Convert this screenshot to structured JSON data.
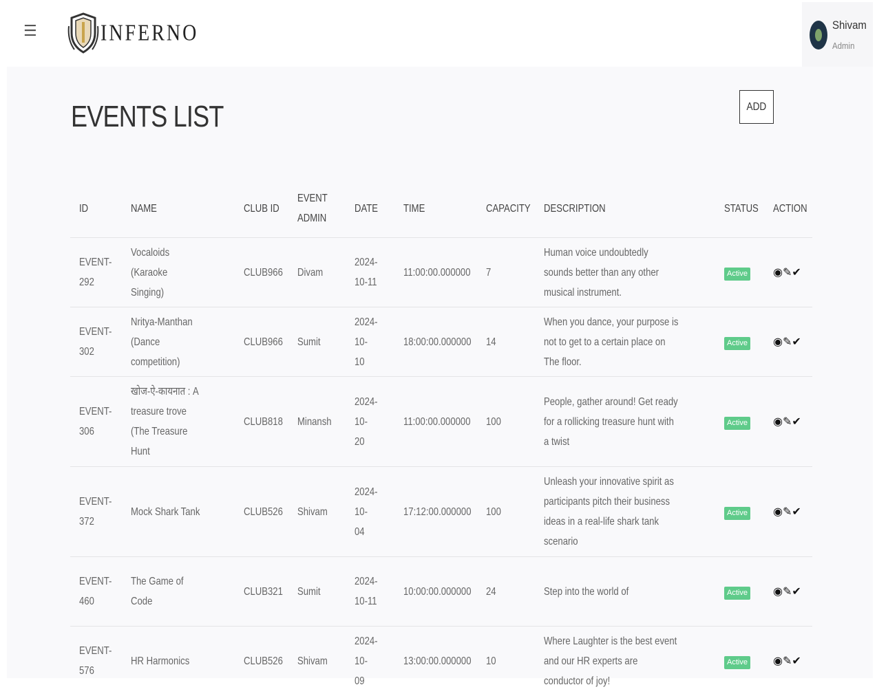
{
  "header": {
    "menu_icon": "hamburger-icon",
    "logo_text": "INFERNO",
    "user": {
      "name": "Shivam",
      "role": "Admin"
    }
  },
  "page": {
    "title": "EVENTS LIST",
    "add_label": "ADD"
  },
  "table": {
    "columns": [
      "ID",
      "NAME",
      "CLUB ID",
      "EVENT ADMIN",
      "DATE",
      "TIME",
      "CAPACITY",
      "DESCRIPTION",
      "STATUS",
      "ACTION"
    ],
    "rows": [
      {
        "id": "EVENT-292",
        "name": "Vocaloids (Karaoke Singing)",
        "club": "CLUB966",
        "admin": "Divam",
        "date": "2024-10-11",
        "time": "11:00:00.000000",
        "capacity": "7",
        "description": "Human voice undoubtedly sounds better than any other musical instrument.",
        "status": "Active"
      },
      {
        "id": "EVENT-302",
        "name": "Nritya-Manthan (Dance competition)",
        "club": "CLUB966",
        "admin": "Sumit",
        "date": "2024-10-10",
        "time": "18:00:00.000000",
        "capacity": "14",
        "description": "When you dance, your purpose is not to get to a certain place on The floor.",
        "status": "Active"
      },
      {
        "id": "EVENT-306",
        "name": "खोज-ऐ-कायनात : A treasure trove (The Treasure Hunt",
        "club": "CLUB818",
        "admin": "Minansh",
        "date": "2024-10-20",
        "time": "11:00:00.000000",
        "capacity": "100",
        "description": "People, gather around! Get ready for a rollicking treasure hunt with a twist",
        "status": "Active"
      },
      {
        "id": "EVENT-372",
        "name": "Mock Shark Tank",
        "club": "CLUB526",
        "admin": "Shivam",
        "date": "2024-10-04",
        "time": "17:12:00.000000",
        "capacity": "100",
        "description": "Unleash your innovative spirit as participants pitch their business ideas in a real-life shark tank scenario",
        "status": "Active"
      },
      {
        "id": "EVENT-460",
        "name": "The Game of Code",
        "club": "CLUB321",
        "admin": "Sumit",
        "date": "2024-10-11",
        "time": "10:00:00.000000",
        "capacity": "24",
        "description": "Step into the world of",
        "status": "Active"
      },
      {
        "id": "EVENT-576",
        "name": "HR Harmonics",
        "club": "CLUB526",
        "admin": "Shivam",
        "date": "2024-10-09",
        "time": "13:00:00.000000",
        "capacity": "10",
        "description": "Where Laughter is the best event and our HR experts are conductor of joy!",
        "status": "Active"
      }
    ],
    "actions": [
      {
        "name": "view-icon",
        "glyph": "◉"
      },
      {
        "name": "edit-icon",
        "glyph": "✎"
      },
      {
        "name": "approve-icon",
        "glyph": "✔"
      }
    ]
  },
  "colors": {
    "active_badge": "#5fcb8a",
    "content_bg": "#f9f9fb"
  }
}
